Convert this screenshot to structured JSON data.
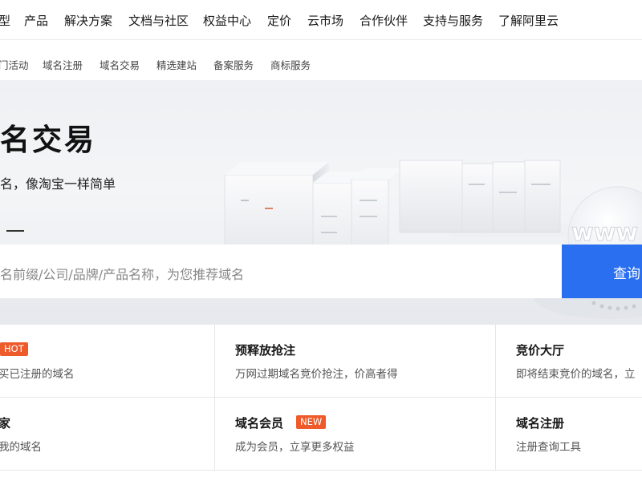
{
  "top_nav": {
    "items": [
      "型",
      "产品",
      "解决方案",
      "文档与社区",
      "权益中心",
      "定价",
      "云市场",
      "合作伙伴",
      "支持与服务",
      "了解阿里云"
    ]
  },
  "sub_nav": {
    "items": [
      "门活动",
      "域名注册",
      "域名交易",
      "精选建站",
      "备案服务",
      "商标服务"
    ]
  },
  "hero": {
    "title": "名交易",
    "subtitle": "名，像淘宝一样简单"
  },
  "search": {
    "placeholder": "名前缀/公司/品牌/产品名称，为您推荐域名",
    "button_label": "查询"
  },
  "cards": [
    {
      "title": "",
      "badge": "HOT",
      "desc": "买已注册的域名"
    },
    {
      "title": "预释放抢注",
      "badge": "",
      "desc": "万网过期域名竞价抢注，价高者得"
    },
    {
      "title": "竞价大厅",
      "badge": "",
      "desc": "即将结束竞价的域名，立"
    },
    {
      "title": "家",
      "badge": "",
      "desc": "我的域名"
    },
    {
      "title": "域名会员",
      "badge": "NEW",
      "desc": "成为会员，立享更多权益"
    },
    {
      "title": "域名注册",
      "badge": "",
      "desc": "注册查询工具"
    }
  ],
  "colors": {
    "accent": "#2a6ff0",
    "badge": "#ef5a2a"
  }
}
